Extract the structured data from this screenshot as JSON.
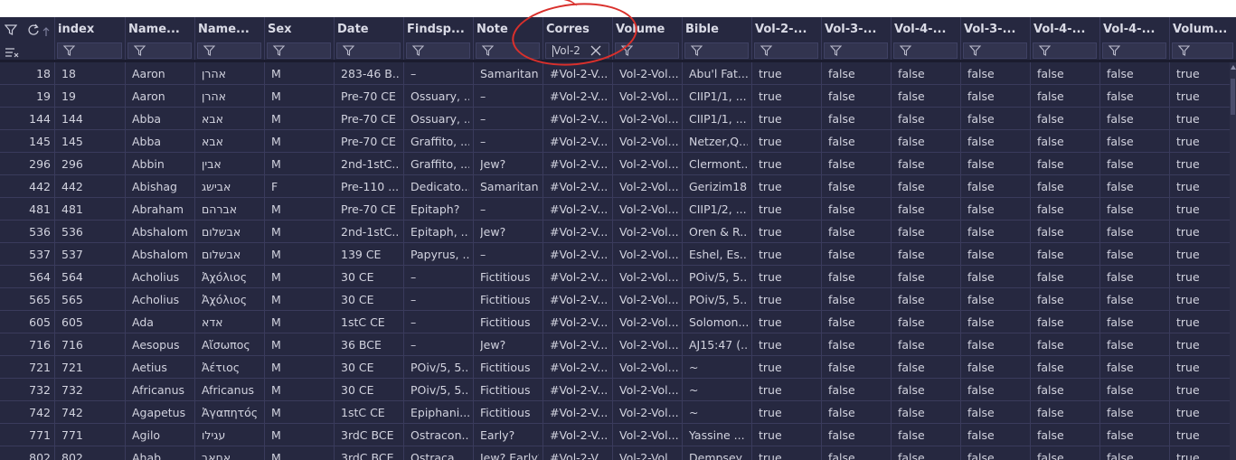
{
  "columns": [
    {
      "key": "rownum",
      "label": ""
    },
    {
      "key": "index",
      "label": "index"
    },
    {
      "key": "name_en",
      "label": "Name..."
    },
    {
      "key": "name_orig",
      "label": "Name..."
    },
    {
      "key": "sex",
      "label": "Sex"
    },
    {
      "key": "date",
      "label": "Date"
    },
    {
      "key": "findspot",
      "label": "Findsp..."
    },
    {
      "key": "note",
      "label": "Note"
    },
    {
      "key": "corres",
      "label": "Corres"
    },
    {
      "key": "volume",
      "label": "Volume"
    },
    {
      "key": "bible",
      "label": "Bible"
    },
    {
      "key": "vol2",
      "label": "Vol-2-..."
    },
    {
      "key": "vol3a",
      "label": "Vol-3-..."
    },
    {
      "key": "vol4a",
      "label": "Vol-4-..."
    },
    {
      "key": "vol3b",
      "label": "Vol-3-..."
    },
    {
      "key": "vol4b",
      "label": "Vol-4-..."
    },
    {
      "key": "vol4c",
      "label": "Vol-4-..."
    },
    {
      "key": "volum",
      "label": "Volum..."
    }
  ],
  "filter": {
    "column": "Corres",
    "value": "Vol-2"
  },
  "toolbar": {
    "filter_icon": "filter-icon",
    "refresh_icon": "refresh-icon",
    "sort_icon": "sort-arrow-icon",
    "clear_filters_icon": "clear-filters-icon"
  },
  "rows": [
    [
      "18",
      "18",
      "Aaron",
      "אהרן",
      "M",
      "283-46 B...",
      "–",
      "Samaritan",
      "#Vol-2-V...",
      "Vol-2-Vol...",
      "Abu'l Fat...",
      "true",
      "false",
      "false",
      "false",
      "false",
      "false",
      "true"
    ],
    [
      "19",
      "19",
      "Aaron",
      "אהרן",
      "M",
      "Pre-70 CE",
      "Ossuary, ...",
      "–",
      "#Vol-2-V...",
      "Vol-2-Vol...",
      "CIIP1/1, ...",
      "true",
      "false",
      "false",
      "false",
      "false",
      "false",
      "true"
    ],
    [
      "144",
      "144",
      "Abba",
      "אבא",
      "M",
      "Pre-70 CE",
      "Ossuary, ...",
      "–",
      "#Vol-2-V...",
      "Vol-2-Vol...",
      "CIIP1/1, ...",
      "true",
      "false",
      "false",
      "false",
      "false",
      "false",
      "true"
    ],
    [
      "145",
      "145",
      "Abba",
      "אבא",
      "M",
      "Pre-70 CE",
      "Graffito, ...",
      "–",
      "#Vol-2-V...",
      "Vol-2-Vol...",
      "Netzer,Q...",
      "true",
      "false",
      "false",
      "false",
      "false",
      "false",
      "true"
    ],
    [
      "296",
      "296",
      "Abbin",
      "אבין",
      "M",
      "2nd-1stC...",
      "Graffito, ...",
      "Jew?",
      "#Vol-2-V...",
      "Vol-2-Vol...",
      "Clermont...",
      "true",
      "false",
      "false",
      "false",
      "false",
      "false",
      "true"
    ],
    [
      "442",
      "442",
      "Abishag",
      "אבישג",
      "F",
      "Pre-110 ...",
      "Dedicato...",
      "Samaritan",
      "#Vol-2-V...",
      "Vol-2-Vol...",
      "Gerizim18",
      "true",
      "false",
      "false",
      "false",
      "false",
      "false",
      "true"
    ],
    [
      "481",
      "481",
      "Abraham",
      "אברהם",
      "M",
      "Pre-70 CE",
      "Epitaph?",
      "–",
      "#Vol-2-V...",
      "Vol-2-Vol...",
      "CIIP1/2, ...",
      "true",
      "false",
      "false",
      "false",
      "false",
      "false",
      "true"
    ],
    [
      "536",
      "536",
      "Abshalom",
      "אבשלום",
      "M",
      "2nd-1stC...",
      "Epitaph, ...",
      "Jew?",
      "#Vol-2-V...",
      "Vol-2-Vol...",
      "Oren & R...",
      "true",
      "false",
      "false",
      "false",
      "false",
      "false",
      "true"
    ],
    [
      "537",
      "537",
      "Abshalom",
      "אבשלום",
      "M",
      "139 CE",
      "Papyrus, ...",
      "–",
      "#Vol-2-V...",
      "Vol-2-Vol...",
      "Eshel, Es...",
      "true",
      "false",
      "false",
      "false",
      "false",
      "false",
      "true"
    ],
    [
      "564",
      "564",
      "Acholius",
      "Ἀχόλιος",
      "M",
      "30 CE",
      "–",
      "Fictitious",
      "#Vol-2-V...",
      "Vol-2-Vol...",
      "POiv/5, 5...",
      "true",
      "false",
      "false",
      "false",
      "false",
      "false",
      "true"
    ],
    [
      "565",
      "565",
      "Acholius",
      "Ἀχόλιος",
      "M",
      "30 CE",
      "–",
      "Fictitious",
      "#Vol-2-V...",
      "Vol-2-Vol...",
      "POiv/5, 5...",
      "true",
      "false",
      "false",
      "false",
      "false",
      "false",
      "true"
    ],
    [
      "605",
      "605",
      "Ada",
      "אדא",
      "M",
      "1stC CE",
      "–",
      "Fictitious",
      "#Vol-2-V...",
      "Vol-2-Vol...",
      "Solomon...",
      "true",
      "false",
      "false",
      "false",
      "false",
      "false",
      "true"
    ],
    [
      "716",
      "716",
      "Aesopus",
      "Αἴσωπος",
      "M",
      "36 BCE",
      "–",
      "Jew?",
      "#Vol-2-V...",
      "Vol-2-Vol...",
      "AJ15:47 (...",
      "true",
      "false",
      "false",
      "false",
      "false",
      "false",
      "true"
    ],
    [
      "721",
      "721",
      "Aetius",
      "Ἀέτιος",
      "M",
      "30 CE",
      "POiv/5, 5...",
      "Fictitious",
      "#Vol-2-V...",
      "Vol-2-Vol...",
      "~",
      "true",
      "false",
      "false",
      "false",
      "false",
      "false",
      "true"
    ],
    [
      "732",
      "732",
      "Africanus",
      "Africanus",
      "M",
      "30 CE",
      "POiv/5, 5...",
      "Fictitious",
      "#Vol-2-V...",
      "Vol-2-Vol...",
      "~",
      "true",
      "false",
      "false",
      "false",
      "false",
      "false",
      "true"
    ],
    [
      "742",
      "742",
      "Agapetus",
      "Ἀγαπητός",
      "M",
      "1stC CE",
      "Epiphani...",
      "Fictitious",
      "#Vol-2-V...",
      "Vol-2-Vol...",
      "~",
      "true",
      "false",
      "false",
      "false",
      "false",
      "false",
      "true"
    ],
    [
      "771",
      "771",
      "Agilo",
      "עגילו",
      "M",
      "3rdC BCE",
      "Ostracon...",
      "Early?",
      "#Vol-2-V...",
      "Vol-2-Vol...",
      "Yassine ...",
      "true",
      "false",
      "false",
      "false",
      "false",
      "false",
      "true"
    ],
    [
      "802",
      "802",
      "Ahab",
      "אחאב",
      "M",
      "3rdC BCE",
      "Ostraca,...",
      "Jew? Early?",
      "#Vol-2-V...",
      "Vol-2-Vol...",
      "Dempsey...",
      "true",
      "false",
      "false",
      "false",
      "false",
      "false",
      "true"
    ]
  ]
}
